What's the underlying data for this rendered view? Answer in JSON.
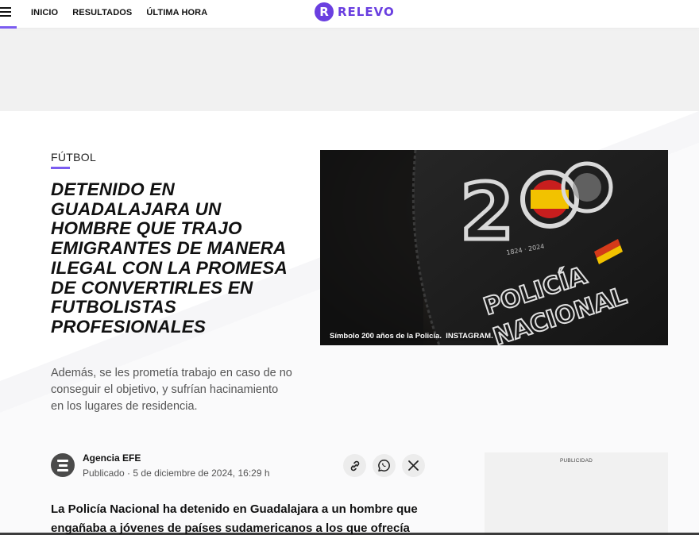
{
  "header": {
    "nav": [
      "INICIO",
      "RESULTADOS",
      "ÚLTIMA HORA"
    ],
    "logo_text": "RELEVO",
    "logo_mark": "R",
    "accent_color": "#7b5cf0",
    "brand_color": "#6a3fe0"
  },
  "article": {
    "category": "FÚTBOL",
    "headline": "DETENIDO EN GUADALAJARA UN HOMBRE QUE TRAJO EMIGRANTES DE MANERA ILEGAL CON LA PROMESA DE CONVERTIRLES EN FUTBOLISTAS PROFESIONALES",
    "subtitle": "Además, se les prometía trabajo en caso de no conseguir el objetivo, y sufrían hacinamiento en los lugares de residencia.",
    "image": {
      "caption_text": "Símbolo 200 años de la Policía.",
      "caption_credit": "INSTAGRAM.",
      "badge_number": "200",
      "badge_years": "1824 · 2024",
      "patch_line1": "POLICÍA",
      "patch_line2": "NACIONAL"
    },
    "author": {
      "name": "Agencia EFE",
      "published_label": "Publicado",
      "published_date": "5 de diciembre de 2024, 16:29 h",
      "icon": "efe-logo-icon"
    },
    "share_icons": [
      "link-icon",
      "whatsapp-icon",
      "x-icon"
    ],
    "lead": "La Policía Nacional ha detenido en Guadalajara a un hombre que engañaba a jóvenes de países sudamericanos a los que ofrecía"
  },
  "ads": {
    "label": "PUBLICIDAD"
  }
}
